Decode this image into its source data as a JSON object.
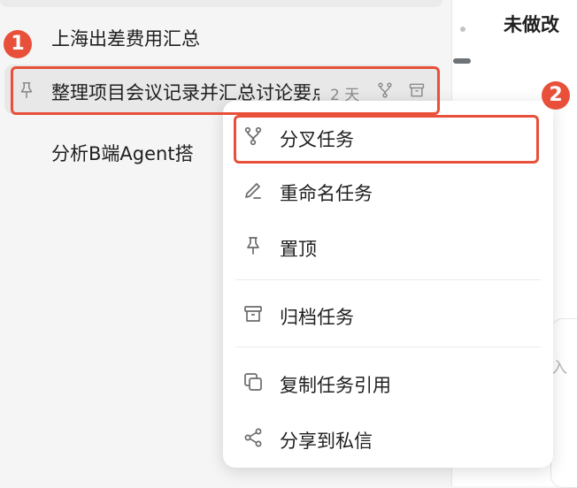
{
  "sidebar": {
    "tasks": [
      {
        "label": "上海出差费用汇总"
      },
      {
        "label": "整理项目会议记录并汇总讨论要点",
        "time": "2 天"
      },
      {
        "label": "分析B端Agent搭"
      }
    ]
  },
  "main": {
    "title": "未做改",
    "input_placeholder": "入"
  },
  "annotations": {
    "marker_1": "1",
    "marker_2": "2",
    "accent": "#e8503a"
  },
  "context_menu": {
    "items": [
      {
        "label": "分叉任务",
        "icon": "fork-icon"
      },
      {
        "label": "重命名任务",
        "icon": "pencil-icon"
      },
      {
        "label": "置顶",
        "icon": "pin-icon"
      },
      {
        "label": "归档任务",
        "icon": "archive-icon"
      },
      {
        "label": "复制任务引用",
        "icon": "copy-icon"
      },
      {
        "label": "分享到私信",
        "icon": "share-icon"
      }
    ]
  }
}
